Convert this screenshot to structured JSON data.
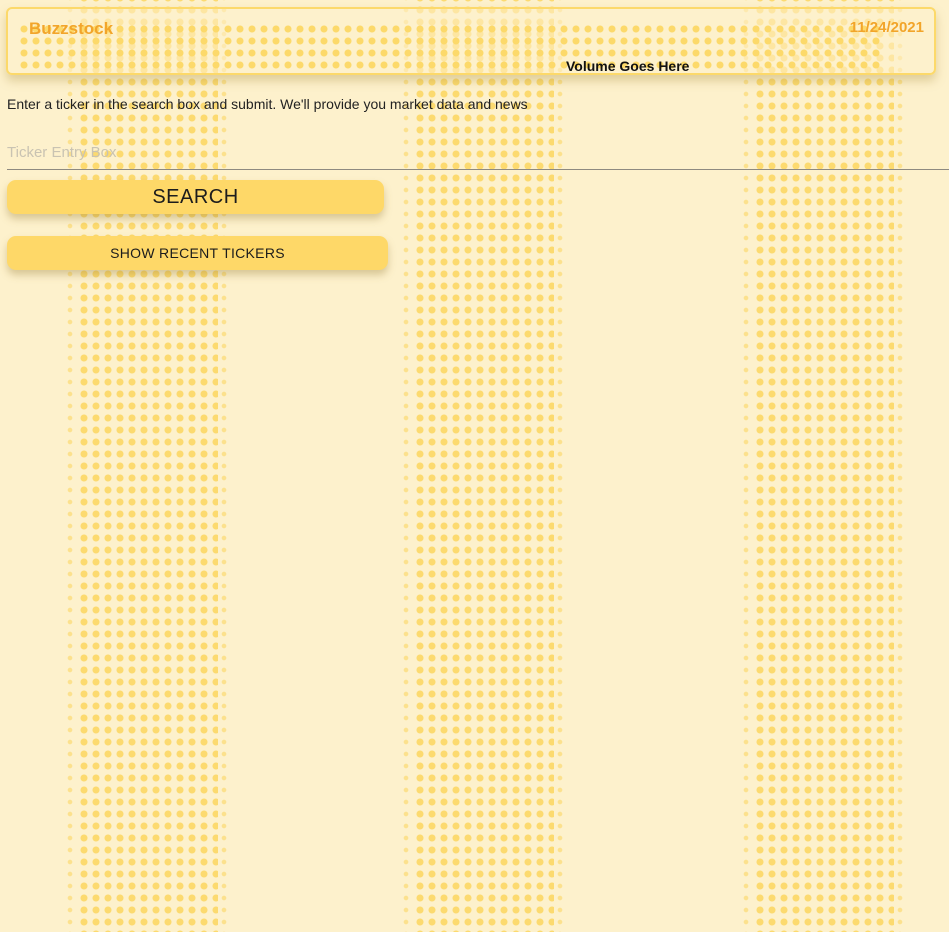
{
  "header": {
    "app_title": "Buzzstock",
    "date": "11/24/2021",
    "volume_text": "Volume Goes Here"
  },
  "main": {
    "instructions": "Enter a ticker in the search box and submit. We'll provide you market data and news",
    "ticker_input": {
      "placeholder": "Ticker Entry Box",
      "value": ""
    },
    "search_button_label": "SEARCH",
    "recent_button_label": "SHOW RECENT TICKERS"
  },
  "colors": {
    "background": "#fdf1cc",
    "accent_dots": "#fcd96a",
    "brand_text": "#f2a52a",
    "button": "#fed868"
  }
}
